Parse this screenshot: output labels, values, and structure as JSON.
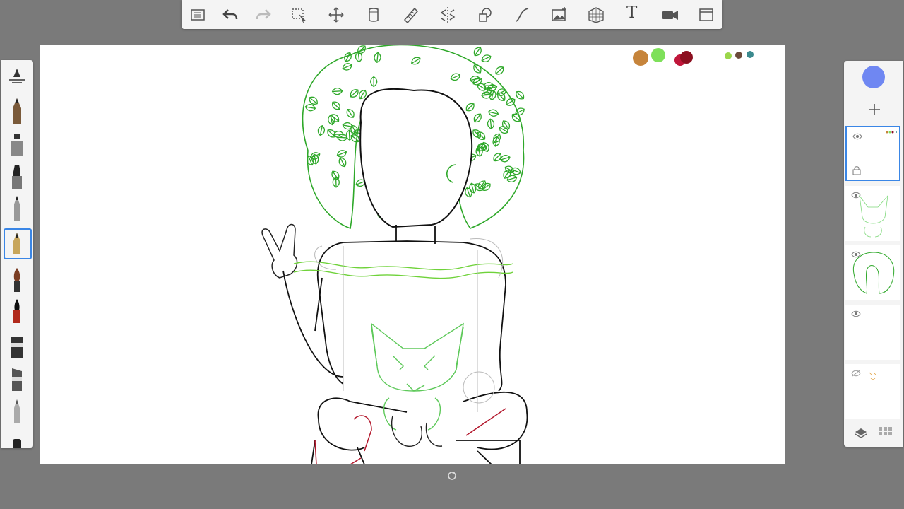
{
  "toolbar": {
    "items": [
      {
        "name": "list-icon"
      },
      {
        "name": "undo-icon"
      },
      {
        "name": "redo-icon"
      },
      {
        "name": "selection-icon"
      },
      {
        "name": "transform-icon"
      },
      {
        "name": "ruler-icon"
      },
      {
        "name": "perspective-ruler-icon"
      },
      {
        "name": "symmetry-icon"
      },
      {
        "name": "shapes-icon"
      },
      {
        "name": "curve-icon"
      },
      {
        "name": "image-icon"
      },
      {
        "name": "perspective-grid-icon"
      },
      {
        "name": "text-tool-label",
        "text": "T"
      },
      {
        "name": "video-icon"
      },
      {
        "name": "fullscreen-icon"
      }
    ]
  },
  "brushes": [
    "brush-settings-icon",
    "pencil-brush",
    "airbrush-brush",
    "marker-brush",
    "ballpoint-brush",
    "fountain-pen-brush",
    "paint-brush",
    "ink-brush",
    "chisel-marker-brush",
    "flat-marker-brush",
    "smudge-brush",
    "eraser-brush"
  ],
  "selected_brush": "fountain-pen-brush",
  "palette_colors": [
    "#c6843b",
    "#7ee05a",
    "#c0163a",
    "#8c1020",
    "#9bd64a",
    "#6b4a3a",
    "#3b8a8e"
  ],
  "current_color": "#6f87f2",
  "layers": [
    {
      "name": "layer-1",
      "visible": true,
      "locked": true,
      "active": true
    },
    {
      "name": "layer-2",
      "visible": true,
      "locked": false,
      "active": false
    },
    {
      "name": "layer-3",
      "visible": true,
      "locked": false,
      "active": false
    },
    {
      "name": "layer-4",
      "visible": true,
      "locked": false,
      "active": false
    },
    {
      "name": "layer-5",
      "visible": false,
      "locked": false,
      "active": false
    }
  ]
}
